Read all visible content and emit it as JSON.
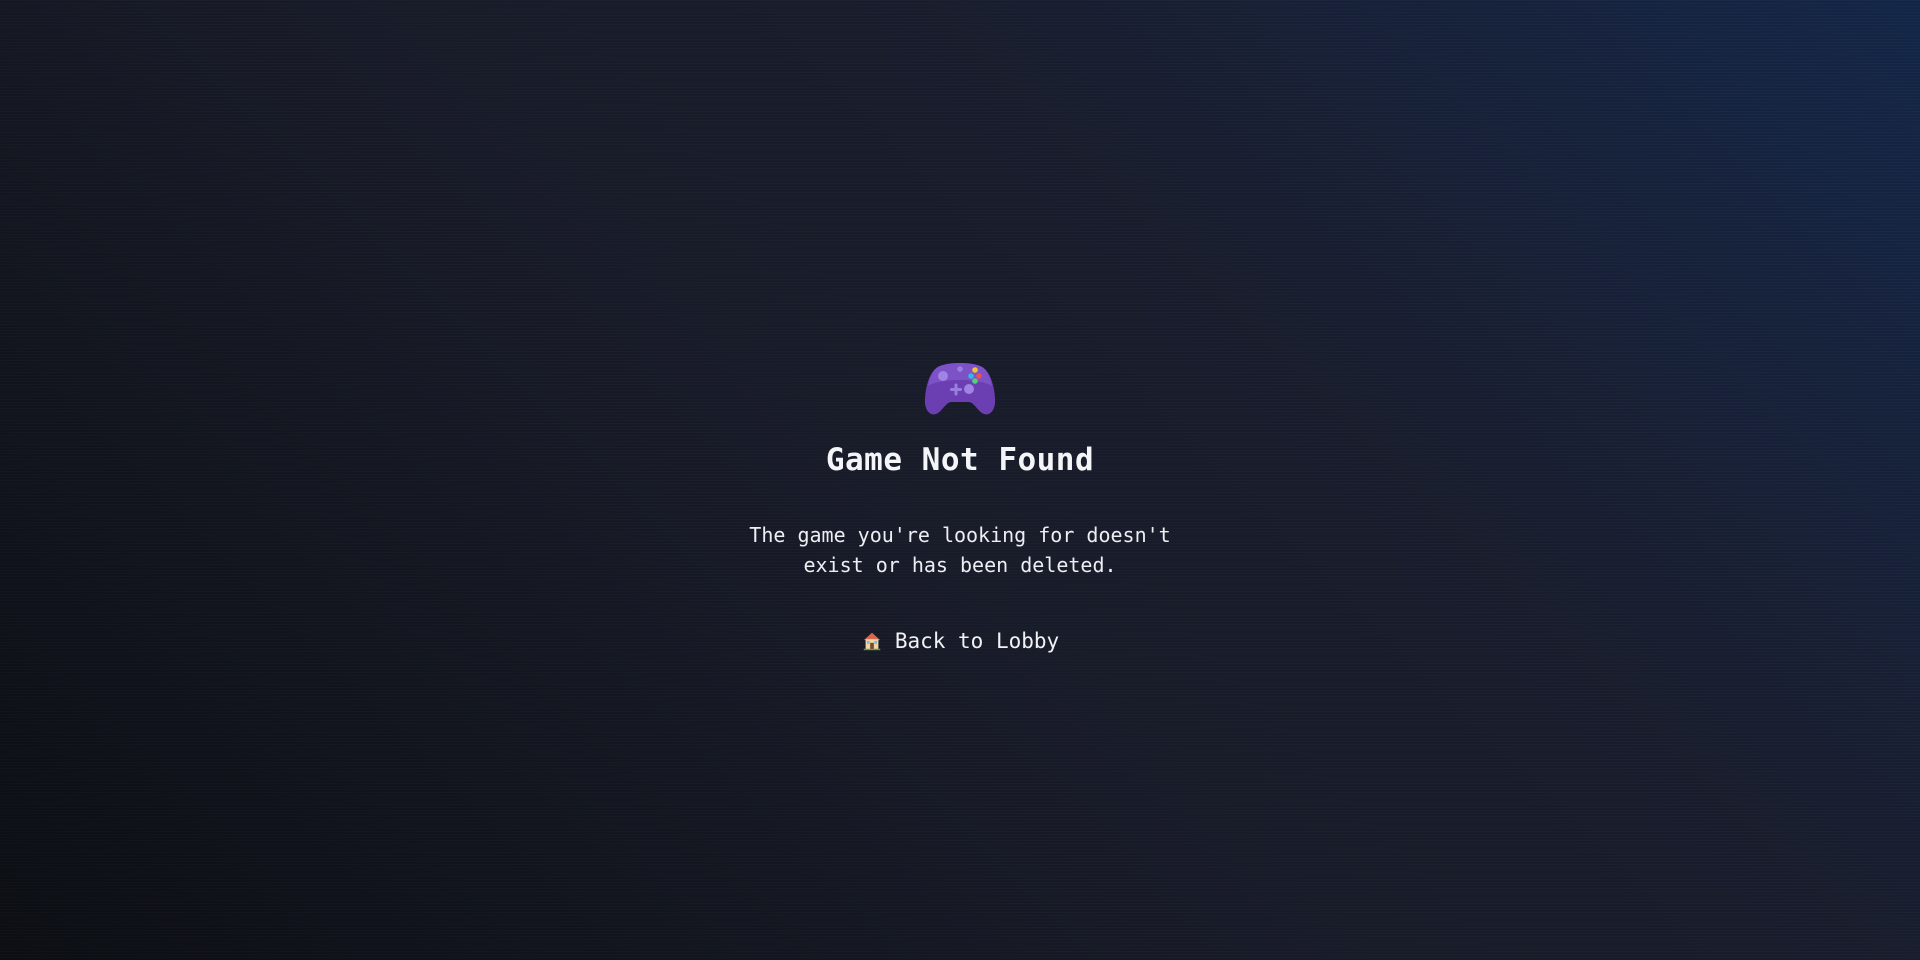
{
  "error": {
    "icon": "game-controller-icon",
    "title": "Game Not Found",
    "message": "The game you're looking for doesn't exist or has been deleted."
  },
  "actions": {
    "back": {
      "icon": "house-icon",
      "label": "Back to Lobby"
    }
  },
  "colors": {
    "background_dark": "#0c0f14",
    "background_mid": "#1a1e2e",
    "background_accent": "#15284a",
    "text": "#f2f3f6",
    "controller": "#6a3fb3"
  }
}
